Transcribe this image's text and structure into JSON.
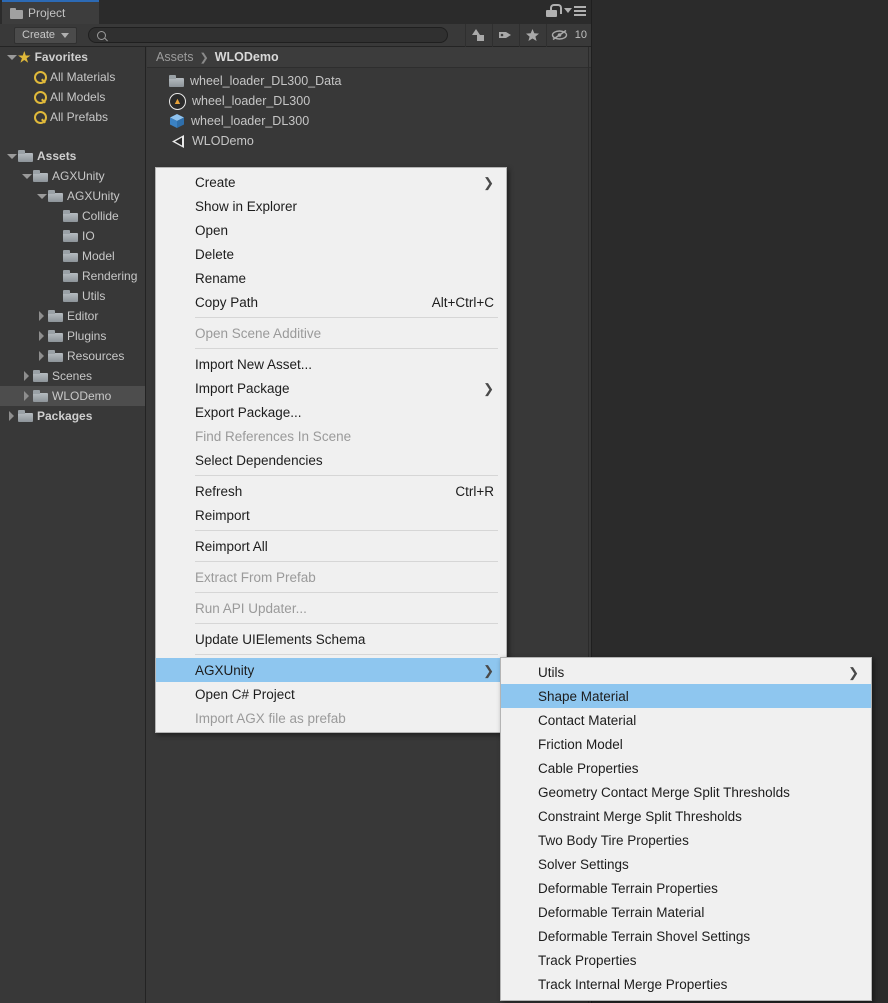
{
  "window": {
    "tab_label": "Project",
    "tab_icon": "folder-icon",
    "lock_icon": "lock-icon",
    "menu_icon": "kebab-menu-icon"
  },
  "toolbar": {
    "create_label": "Create",
    "create_caret": "▾",
    "search_placeholder": "",
    "search_value": "",
    "search_icon": "search-icon",
    "icons": [
      {
        "name": "shapes-filter-icon"
      },
      {
        "name": "label-tag-icon"
      },
      {
        "name": "favorite-star-icon"
      },
      {
        "name": "hidden-eye-icon"
      }
    ],
    "hidden_count": "10"
  },
  "tree": {
    "items": [
      {
        "label": "Favorites",
        "depth": 0,
        "twisty": "down",
        "icon": "star-icon",
        "bold": true,
        "selected": false
      },
      {
        "label": "All Materials",
        "depth": 1,
        "twisty": "none",
        "icon": "search-icon",
        "bold": false,
        "selected": false
      },
      {
        "label": "All Models",
        "depth": 1,
        "twisty": "none",
        "icon": "search-icon",
        "bold": false,
        "selected": false
      },
      {
        "label": "All Prefabs",
        "depth": 1,
        "twisty": "none",
        "icon": "search-icon",
        "bold": false,
        "selected": false
      },
      {
        "label": "",
        "depth": 0,
        "twisty": "none",
        "icon": "none",
        "bold": false,
        "selected": false
      },
      {
        "label": "Assets",
        "depth": 0,
        "twisty": "down",
        "icon": "folder-icon",
        "bold": true,
        "selected": false
      },
      {
        "label": "AGXUnity",
        "depth": 1,
        "twisty": "down",
        "icon": "folder-icon",
        "bold": false,
        "selected": false
      },
      {
        "label": "AGXUnity",
        "depth": 2,
        "twisty": "down",
        "icon": "folder-icon",
        "bold": false,
        "selected": false
      },
      {
        "label": "Collide",
        "depth": 3,
        "twisty": "none",
        "icon": "folder-icon",
        "bold": false,
        "selected": false
      },
      {
        "label": "IO",
        "depth": 3,
        "twisty": "none",
        "icon": "folder-icon",
        "bold": false,
        "selected": false
      },
      {
        "label": "Model",
        "depth": 3,
        "twisty": "none",
        "icon": "folder-icon",
        "bold": false,
        "selected": false
      },
      {
        "label": "Rendering",
        "depth": 3,
        "twisty": "none",
        "icon": "folder-icon",
        "bold": false,
        "selected": false
      },
      {
        "label": "Utils",
        "depth": 3,
        "twisty": "none",
        "icon": "folder-icon",
        "bold": false,
        "selected": false
      },
      {
        "label": "Editor",
        "depth": 2,
        "twisty": "right",
        "icon": "folder-icon",
        "bold": false,
        "selected": false
      },
      {
        "label": "Plugins",
        "depth": 2,
        "twisty": "right",
        "icon": "folder-icon",
        "bold": false,
        "selected": false
      },
      {
        "label": "Resources",
        "depth": 2,
        "twisty": "right",
        "icon": "folder-icon",
        "bold": false,
        "selected": false
      },
      {
        "label": "Scenes",
        "depth": 1,
        "twisty": "right",
        "icon": "folder-icon",
        "bold": false,
        "selected": false
      },
      {
        "label": "WLODemo",
        "depth": 1,
        "twisty": "right",
        "icon": "folder-icon",
        "bold": false,
        "selected": true
      },
      {
        "label": "Packages",
        "depth": 0,
        "twisty": "right",
        "icon": "folder-icon",
        "bold": true,
        "selected": false
      }
    ]
  },
  "breadcrumb": {
    "root": "Assets",
    "separator": "❯",
    "current": "WLODemo"
  },
  "files": [
    {
      "label": "wheel_loader_DL300_Data",
      "icon": "folder-icon"
    },
    {
      "label": "wheel_loader_DL300",
      "icon": "agx-asset-icon"
    },
    {
      "label": "wheel_loader_DL300",
      "icon": "prefab-cube-icon"
    },
    {
      "label": "WLODemo",
      "icon": "unity-scene-icon"
    }
  ],
  "context_menu": {
    "items": [
      {
        "label": "Create",
        "shortcut": "",
        "submenu": true,
        "disabled": false,
        "highlighted": false,
        "sep_after": false
      },
      {
        "label": "Show in Explorer",
        "shortcut": "",
        "submenu": false,
        "disabled": false,
        "highlighted": false,
        "sep_after": false
      },
      {
        "label": "Open",
        "shortcut": "",
        "submenu": false,
        "disabled": false,
        "highlighted": false,
        "sep_after": false
      },
      {
        "label": "Delete",
        "shortcut": "",
        "submenu": false,
        "disabled": false,
        "highlighted": false,
        "sep_after": false
      },
      {
        "label": "Rename",
        "shortcut": "",
        "submenu": false,
        "disabled": false,
        "highlighted": false,
        "sep_after": false
      },
      {
        "label": "Copy Path",
        "shortcut": "Alt+Ctrl+C",
        "submenu": false,
        "disabled": false,
        "highlighted": false,
        "sep_after": true
      },
      {
        "label": "Open Scene Additive",
        "shortcut": "",
        "submenu": false,
        "disabled": true,
        "highlighted": false,
        "sep_after": true
      },
      {
        "label": "Import New Asset...",
        "shortcut": "",
        "submenu": false,
        "disabled": false,
        "highlighted": false,
        "sep_after": false
      },
      {
        "label": "Import Package",
        "shortcut": "",
        "submenu": true,
        "disabled": false,
        "highlighted": false,
        "sep_after": false
      },
      {
        "label": "Export Package...",
        "shortcut": "",
        "submenu": false,
        "disabled": false,
        "highlighted": false,
        "sep_after": false
      },
      {
        "label": "Find References In Scene",
        "shortcut": "",
        "submenu": false,
        "disabled": true,
        "highlighted": false,
        "sep_after": false
      },
      {
        "label": "Select Dependencies",
        "shortcut": "",
        "submenu": false,
        "disabled": false,
        "highlighted": false,
        "sep_after": true
      },
      {
        "label": "Refresh",
        "shortcut": "Ctrl+R",
        "submenu": false,
        "disabled": false,
        "highlighted": false,
        "sep_after": false
      },
      {
        "label": "Reimport",
        "shortcut": "",
        "submenu": false,
        "disabled": false,
        "highlighted": false,
        "sep_after": true
      },
      {
        "label": "Reimport All",
        "shortcut": "",
        "submenu": false,
        "disabled": false,
        "highlighted": false,
        "sep_after": true
      },
      {
        "label": "Extract From Prefab",
        "shortcut": "",
        "submenu": false,
        "disabled": true,
        "highlighted": false,
        "sep_after": true
      },
      {
        "label": "Run API Updater...",
        "shortcut": "",
        "submenu": false,
        "disabled": true,
        "highlighted": false,
        "sep_after": true
      },
      {
        "label": "Update UIElements Schema",
        "shortcut": "",
        "submenu": false,
        "disabled": false,
        "highlighted": false,
        "sep_after": true
      },
      {
        "label": "AGXUnity",
        "shortcut": "",
        "submenu": true,
        "disabled": false,
        "highlighted": true,
        "sep_after": false
      },
      {
        "label": "Open C# Project",
        "shortcut": "",
        "submenu": false,
        "disabled": false,
        "highlighted": false,
        "sep_after": false
      },
      {
        "label": "Import AGX file as prefab",
        "shortcut": "",
        "submenu": false,
        "disabled": true,
        "highlighted": false,
        "sep_after": false
      }
    ]
  },
  "submenu": {
    "items": [
      {
        "label": "Utils",
        "submenu": true,
        "highlighted": false
      },
      {
        "label": "Shape Material",
        "submenu": false,
        "highlighted": true
      },
      {
        "label": "Contact Material",
        "submenu": false,
        "highlighted": false
      },
      {
        "label": "Friction Model",
        "submenu": false,
        "highlighted": false
      },
      {
        "label": "Cable Properties",
        "submenu": false,
        "highlighted": false
      },
      {
        "label": "Geometry Contact Merge Split Thresholds",
        "submenu": false,
        "highlighted": false
      },
      {
        "label": "Constraint Merge Split Thresholds",
        "submenu": false,
        "highlighted": false
      },
      {
        "label": "Two Body Tire Properties",
        "submenu": false,
        "highlighted": false
      },
      {
        "label": "Solver Settings",
        "submenu": false,
        "highlighted": false
      },
      {
        "label": "Deformable Terrain Properties",
        "submenu": false,
        "highlighted": false
      },
      {
        "label": "Deformable Terrain Material",
        "submenu": false,
        "highlighted": false
      },
      {
        "label": "Deformable Terrain Shovel Settings",
        "submenu": false,
        "highlighted": false
      },
      {
        "label": "Track Properties",
        "submenu": false,
        "highlighted": false
      },
      {
        "label": "Track Internal Merge Properties",
        "submenu": false,
        "highlighted": false
      }
    ]
  },
  "colors": {
    "editor_bg": "#383838",
    "chrome_bg": "#2b2b2b",
    "menu_bg": "#f0f0f0",
    "highlight": "#8ec6ef",
    "tab_accent": "#2c6ab5",
    "selection_row": "#4d4d4d",
    "favorite_yellow": "#e0b93a"
  }
}
